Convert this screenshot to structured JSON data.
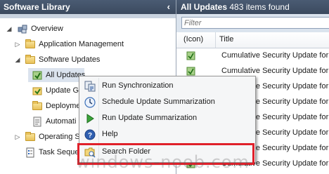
{
  "left_pane": {
    "title": "Software Library",
    "tree": [
      {
        "label": "Overview"
      },
      {
        "label": "Application Management"
      },
      {
        "label": "Software Updates"
      },
      {
        "label": "All Updates"
      },
      {
        "label": "Update G"
      },
      {
        "label": "Deployme"
      },
      {
        "label": "Automati"
      },
      {
        "label": "Operating S"
      },
      {
        "label": "Task Seque"
      }
    ]
  },
  "right_pane": {
    "title": "All Updates",
    "count_text": "483 items found",
    "filter_placeholder": "Filter",
    "columns": {
      "icon": "(Icon)",
      "title": "Title"
    },
    "rows": [
      "Cumulative Security Update for",
      "Cumulative Security Update for",
      "Cumulative Security Update for",
      "Cumulative Security Update for",
      "Cumulative Security Update for",
      "Cumulative Security Update for",
      "Cumulative Security Update for",
      "Cumulative Security Update for"
    ]
  },
  "context_menu": {
    "items": [
      {
        "label": "Run Synchronization",
        "icon": "sync-icon"
      },
      {
        "label": "Schedule Update Summarization",
        "icon": "clock-icon"
      },
      {
        "label": "Run Update Summarization",
        "icon": "play-icon"
      },
      {
        "label": "Help",
        "icon": "help-icon"
      },
      {
        "label": "Search Folder",
        "icon": "search-folder-icon"
      }
    ]
  },
  "watermark": "windows-noob.com",
  "colors": {
    "header": "#3b4a5f",
    "highlight": "#e0202a",
    "filter_bar": "#dbe4ee"
  }
}
